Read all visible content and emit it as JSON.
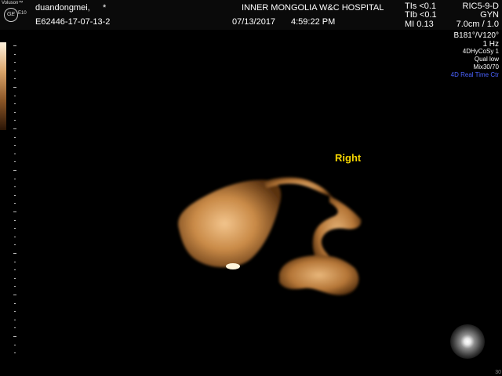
{
  "header": {
    "brand": "Voluson™",
    "model": "E10",
    "ge_mark": "GE",
    "patient_name": "duandongmei,",
    "patient_marker": "*",
    "exam_id": "E62446-17-07-13-2",
    "hospital": "INNER MONGOLIA W&C HOSPITAL",
    "date": "07/13/2017",
    "time": "4:59:22 PM",
    "tis": "TIs <0.1",
    "tib": "TIb <0.1",
    "mi": "MI 0.13",
    "probe": "RIC5-9-D",
    "app": "GYN",
    "depth": "7.0cm / 1.0"
  },
  "params": {
    "angle": "B181°/V120°",
    "rate": "1 Hz",
    "mode": "4DHyCoSy 1",
    "quality": "Qual low",
    "mix": "Mix30/70",
    "status": "4D Real Time Ctr"
  },
  "annotation": {
    "label": "Right"
  },
  "icons": {
    "light_source": "light-source-icon",
    "logo": "ge-logo-icon"
  },
  "colors": {
    "status_text": "#4a62ff",
    "annotation": "#f4d400",
    "render": "#c88a45"
  },
  "footer": {
    "frame": "30"
  }
}
